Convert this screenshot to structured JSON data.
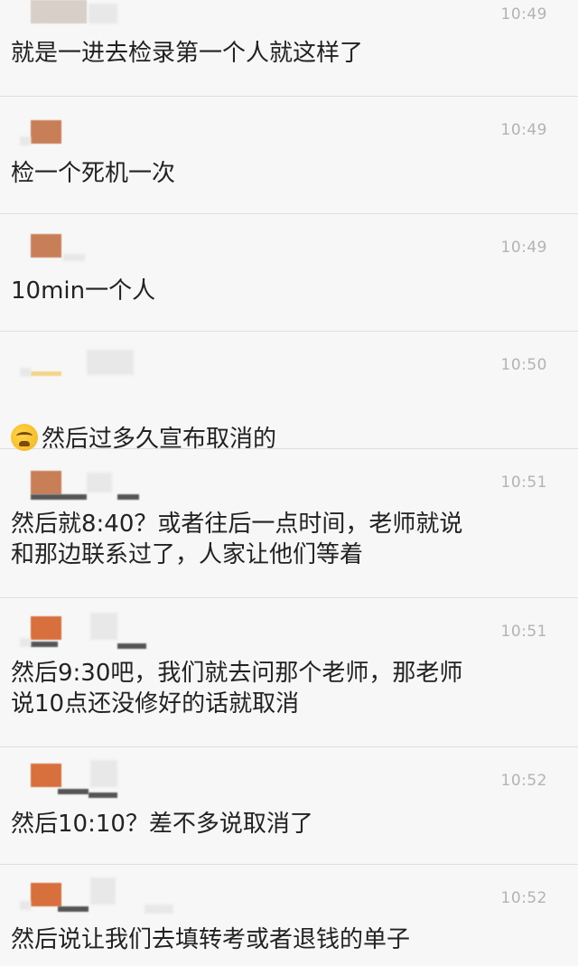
{
  "messages": [
    {
      "time": "10:49",
      "text": "就是一进去检录第一个人就这样了"
    },
    {
      "time": "10:49",
      "text": "检一个死机一次"
    },
    {
      "time": "10:49",
      "text": "10min一个人"
    },
    {
      "time": "10:50",
      "emoji": "crying-laughing-emoji",
      "text": "然后过多久宣布取消的"
    },
    {
      "time": "10:51",
      "text": "然后就8:40？或者往后一点时间，老师就说\n和那边联系过了，人家让他们等着"
    },
    {
      "time": "10:51",
      "text": "然后9:30吧，我们就去问那个老师，那老师\n说10点还没修好的话就取消"
    },
    {
      "time": "10:52",
      "text": "然后10:10？差不多说取消了"
    },
    {
      "time": "10:52",
      "text": "然后说让我们去填转考或者退钱的单子"
    }
  ],
  "colors": {
    "background": "#f7f7f7",
    "divider": "#dedede",
    "time": "#b3b3b3",
    "text": "#222222",
    "avatar": "#c87f58"
  }
}
